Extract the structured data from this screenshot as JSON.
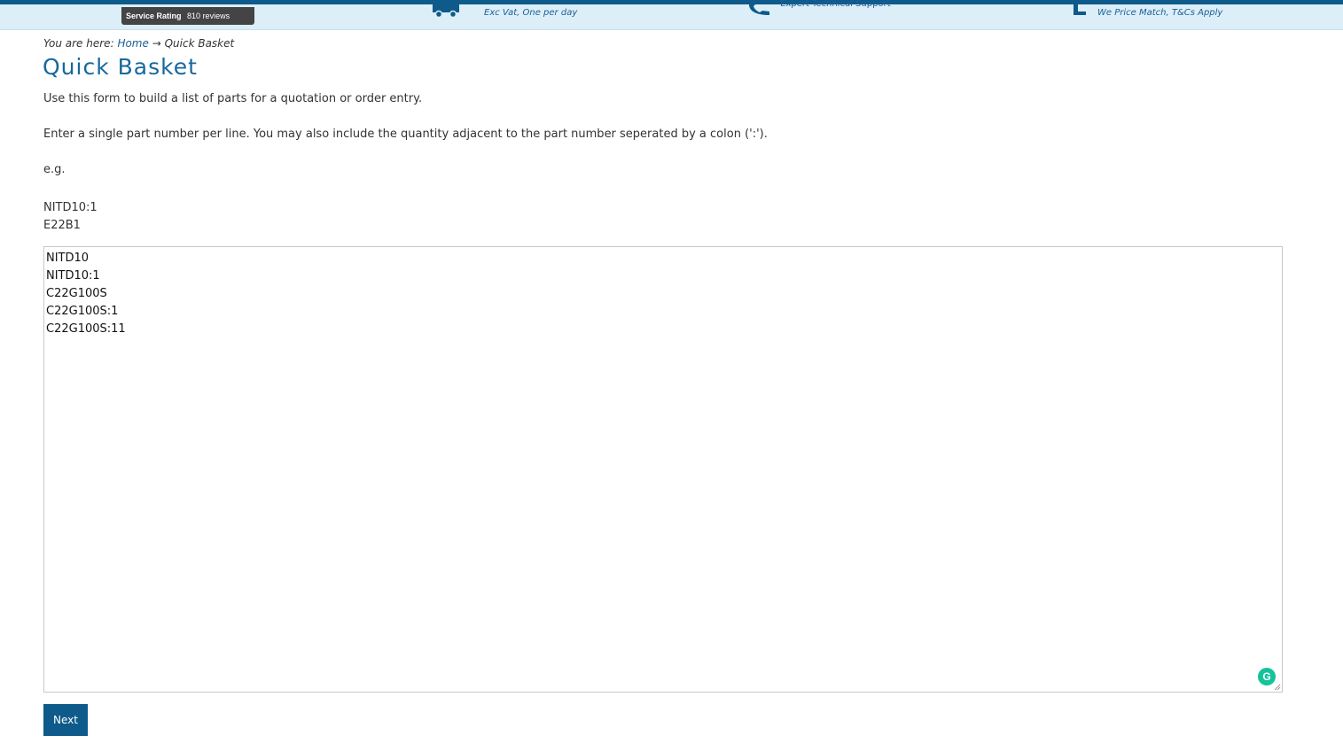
{
  "header": {
    "rating_label": "Service Rating",
    "rating_count": "810 reviews",
    "usps": [
      {
        "icon": "truck-icon",
        "text": "Exc Vat, One per day"
      },
      {
        "icon": "phone-icon",
        "text": "Expert Technical Support"
      },
      {
        "icon": "price-match-icon",
        "text": "We Price Match, T&Cs Apply"
      }
    ]
  },
  "breadcrumb": {
    "prefix": "You are here:",
    "home": "Home",
    "separator": "→",
    "current": "Quick Basket"
  },
  "page": {
    "title": "Quick Basket",
    "intro": "Use this form to build a list of parts for a quotation or order entry.",
    "instructions": "Enter a single part number per line. You may also include the quantity adjacent to the part number seperated by a colon (':').",
    "example_label": "e.g.",
    "example_lines": [
      "NITD10:1",
      "E22B1"
    ]
  },
  "editor": {
    "lines": [
      "NITD10",
      "NITD10:1",
      "C22G100S",
      "C22G100S:1",
      "C22G100S:11"
    ],
    "grammarly_letter": "G"
  },
  "actions": {
    "next_label": "Next"
  },
  "colors": {
    "brand": "#0e5a8a",
    "title": "#17689e",
    "strip": "#dceef8",
    "grammarly": "#15c39a"
  }
}
